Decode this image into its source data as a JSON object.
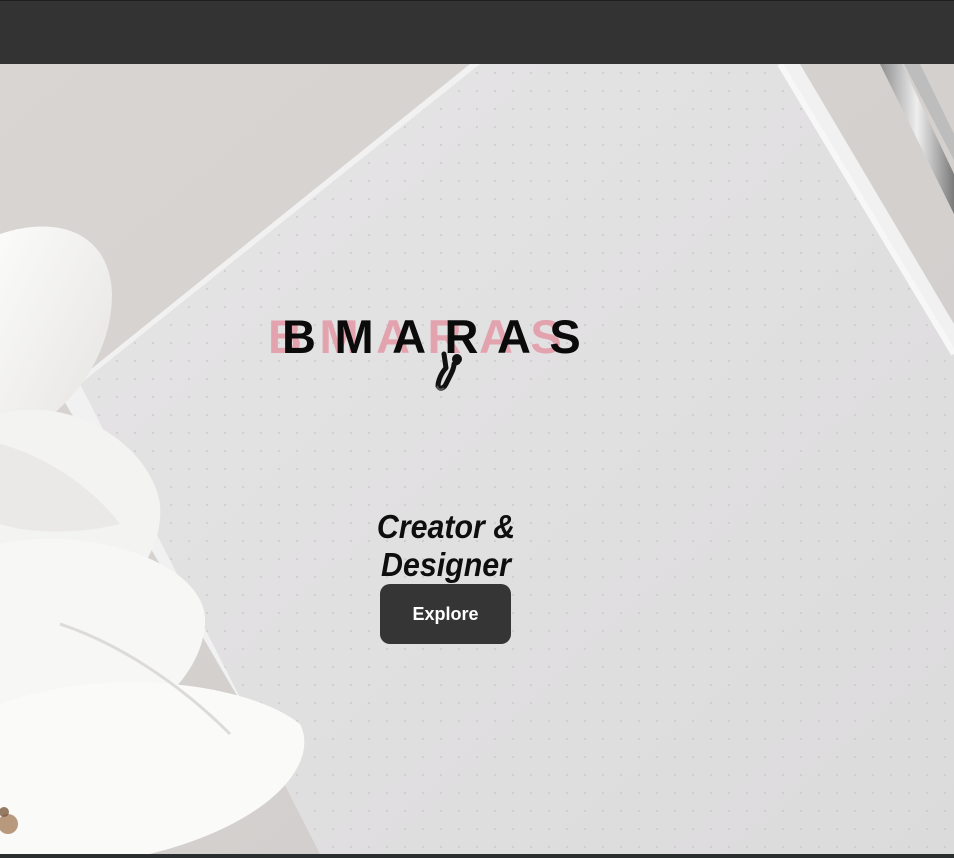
{
  "brand": {
    "shadow_text": "BMARAS",
    "main_text": "BMARAS"
  },
  "hero": {
    "tagline": "Creator & Designer",
    "button_label": "Explore"
  },
  "colors": {
    "nav": "#333333",
    "accent_pink": "#e3a3ae",
    "button": "#353535",
    "text": "#0b0b0b"
  },
  "icons": {
    "cursor": "climbing-figure-cursor-icon"
  }
}
